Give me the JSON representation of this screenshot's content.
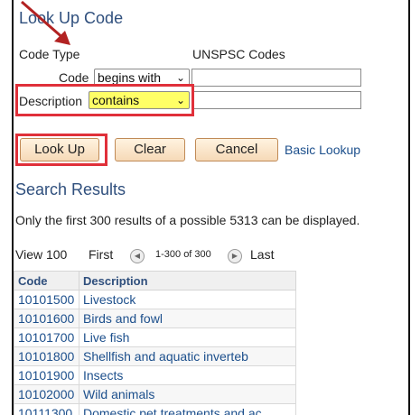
{
  "dialog": {
    "title": "Look Up Code"
  },
  "code_type": {
    "label": "Code Type",
    "value": "UNSPSC Codes"
  },
  "code": {
    "label": "Code",
    "operator": "begins with",
    "value": ""
  },
  "description": {
    "label": "Description",
    "operator": "contains",
    "value": ""
  },
  "buttons": {
    "lookup": "Look Up",
    "clear": "Clear",
    "cancel": "Cancel",
    "basic": "Basic Lookup"
  },
  "results": {
    "heading": "Search Results",
    "note": "Only the first 300 results of a possible 5313 can be displayed.",
    "nav": {
      "view": "View 100",
      "first": "First",
      "range": "1-300 of 300",
      "last": "Last"
    },
    "columns": [
      "Code",
      "Description"
    ],
    "rows": [
      [
        "10101500",
        "Livestock"
      ],
      [
        "10101600",
        "Birds and fowl"
      ],
      [
        "10101700",
        "Live fish"
      ],
      [
        "10101800",
        "Shellfish and aquatic inverteb"
      ],
      [
        "10101900",
        "Insects"
      ],
      [
        "10102000",
        "Wild animals"
      ],
      [
        "10111300",
        "Domestic pet treatments and ac"
      ]
    ]
  },
  "colors": {
    "highlight_border": "#e0303a",
    "highlight_fill": "#ffff66",
    "arrow": "#b22222",
    "link": "#1c4f8c"
  }
}
